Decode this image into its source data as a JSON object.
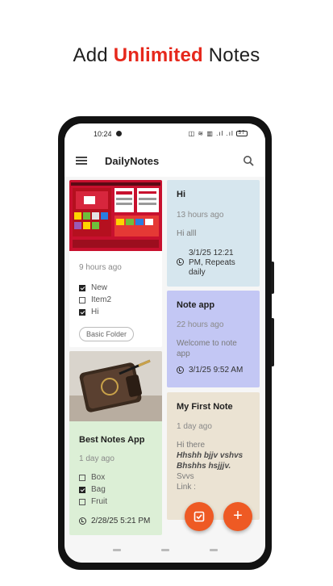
{
  "promo": {
    "prefix": "Add",
    "highlight": "Unlimited",
    "suffix": "Notes"
  },
  "status": {
    "time": "10:24",
    "icons": "◫ ≋ ▥ .ıl .ıl",
    "battery": "57"
  },
  "appbar": {
    "title": "DailyNotes"
  },
  "notes": {
    "n1": {
      "time": "9 hours ago",
      "items": [
        {
          "label": "New",
          "checked": true
        },
        {
          "label": "Item2",
          "checked": false
        },
        {
          "label": "Hi",
          "checked": true
        }
      ],
      "folder": "Basic Folder"
    },
    "n2": {
      "title": "Best Notes App",
      "time": "1 day ago",
      "items": [
        {
          "label": "Box",
          "checked": false
        },
        {
          "label": "Bag",
          "checked": true
        },
        {
          "label": "Fruit",
          "checked": false
        }
      ],
      "reminder": "2/28/25 5:21 PM",
      "color": "#dcefd6"
    },
    "n3": {
      "title": "Hi",
      "time": "13 hours ago",
      "body": "Hi alll",
      "reminder": "3/1/25 12:21 PM, Repeats daily",
      "color": "#d6e6ee"
    },
    "n4": {
      "title": "Note app",
      "time": "22 hours ago",
      "body": "Welcome to note app",
      "reminder": "3/1/25 9:52 AM",
      "color": "#c3c7f4"
    },
    "n5": {
      "title": "My First Note",
      "time": "1 day ago",
      "body1": "Hi there",
      "body2": "Hhshh bjjv vshvs Bhshhs hsjjjv.",
      "body3": "Svvs",
      "body4": "Link :",
      "color": "#ebe3d3"
    }
  },
  "colors": {
    "accent": "#ee5a24",
    "promo_highlight": "#e6281c"
  }
}
